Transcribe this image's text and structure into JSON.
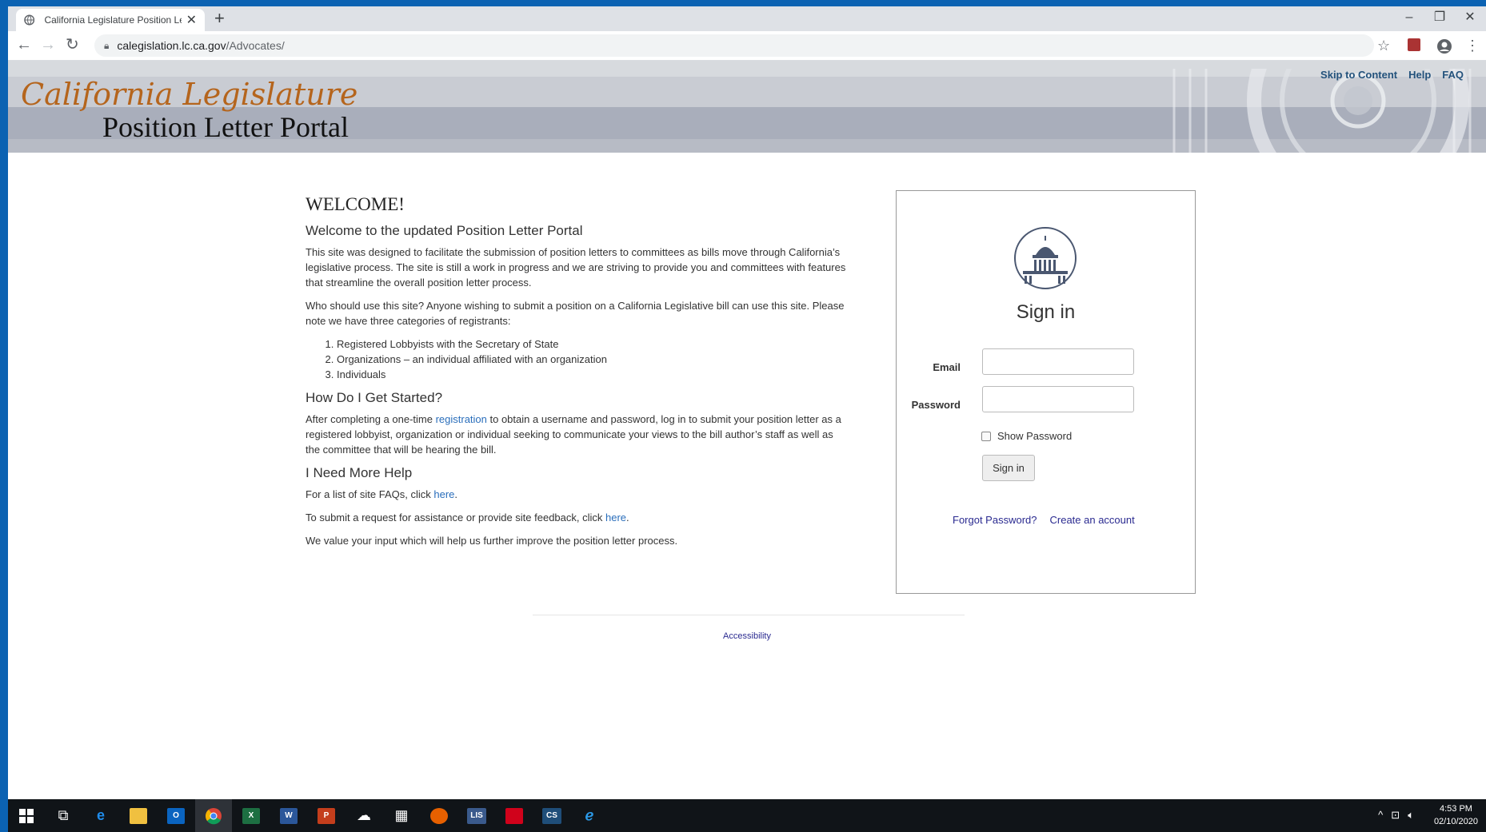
{
  "browser": {
    "tab_title": "California Legislature Position Letter Portal",
    "new_tab": "+",
    "close_tab": "✕",
    "url_host": "calegislation.lc.ca.gov",
    "url_path": "/Advocates/",
    "window_controls": [
      "–",
      "❐",
      "✕"
    ]
  },
  "header": {
    "utility_links": [
      "Skip to Content",
      "Help",
      "FAQ"
    ],
    "logo_script": "California Legislature",
    "logo_sub": "Position Letter Portal"
  },
  "main": {
    "welcome": "WELCOME!",
    "subtitle": "Welcome to the updated Position Letter Portal",
    "intro": "This site was designed to facilitate the submission of position letters to committees as bills move through California’s legislative process. The site is still a work in progress and we are striving to provide you and committees with features that streamline the overall position letter process.",
    "who": "Who should use this site? Anyone wishing to submit a position on a California Legislative bill can use this site. Please note we have three categories of registrants:",
    "registrants": [
      "Registered Lobbyists with the Secretary of State",
      "Organizations – an individual affiliated with an organization",
      "Individuals"
    ],
    "started_heading": "How Do I Get Started?",
    "started_pre": "After completing a one-time ",
    "started_link": "registration",
    "started_post": " to obtain a username and password, log in to submit your position letter as a registered lobbyist, organization or individual seeking to communicate your views to the bill author’s staff as well as the committee that will be hearing the bill.",
    "help_heading": "I Need More Help",
    "faq_pre": "For a list of site FAQs, click ",
    "faq_link": "here",
    "faq_post": ".",
    "assist_pre": "To submit a request for assistance or provide site feedback, click ",
    "assist_link": "here",
    "assist_post": ".",
    "value": "We value your input which will help us further improve the position letter process."
  },
  "signin": {
    "title": "Sign in",
    "email_label": "Email",
    "email_value": "",
    "password_label": "Password",
    "password_value": "",
    "show_password": "Show Password",
    "button": "Sign in",
    "forgot": "Forgot Password?",
    "create": "Create an account"
  },
  "footer": {
    "accessibility": "Accessibility"
  },
  "taskbar": {
    "apps": [
      "start-icon",
      "task-view-icon",
      "edge-icon",
      "file-explorer-icon",
      "outlook-icon",
      "chrome-icon",
      "excel-icon",
      "word-icon",
      "powerpoint-icon",
      "app-icon",
      "calculator-icon",
      "firefox-icon",
      "lis-icon",
      "acrobat-icon",
      "cs-icon",
      "ie-icon"
    ],
    "lis_label": "LIS",
    "cs_label": "CS",
    "time": "4:53 PM",
    "date": "02/10/2020"
  }
}
